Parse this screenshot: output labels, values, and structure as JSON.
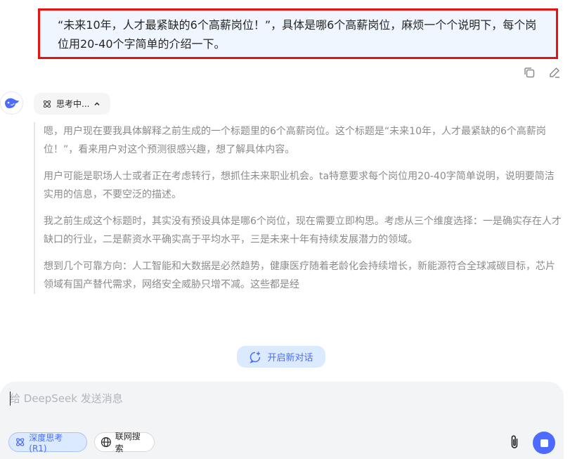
{
  "user_message": {
    "text": "“未来10年，人才最紧缺的6个高薪岗位！”，具体是哪6个高薪岗位，麻烦一个个说明下，每个岗位用20-40个字简单的介绍一下。"
  },
  "message_actions": {
    "copy_icon": "copy-icon",
    "edit_icon": "edit-icon"
  },
  "assistant": {
    "avatar_icon": "deepseek-whale-icon",
    "thinking_label": "思考中...",
    "thinking_paragraphs": [
      "嗯，用户现在要我具体解释之前生成的一个标题里的6个高薪岗位。这个标题是“未来10年，人才最紧缺的6个高薪岗位！”，看来用户对这个预测很感兴趣，想了解具体内容。",
      "用户可能是职场人士或者正在考虑转行，想抓住未来职业机会。ta特意要求每个岗位用20-40字简单说明，说明要简洁实用的信息，不要空泛的描述。",
      "我之前生成这个标题时，其实没有预设具体是哪6个岗位，现在需要立即构思。考虑从三个维度选择：一是确实存在人才缺口的行业，二是薪资水平确实高于平均水平，三是未来十年有持续发展潜力的领域。",
      "想到几个可靠方向：人工智能和大数据是必然趋势，健康医疗随着老龄化会持续增长，新能源符合全球减碳目标，芯片领域有国产替代需求，网络安全威胁只增不减。这些都是经"
    ]
  },
  "new_chat": {
    "label": "开启新对话"
  },
  "composer": {
    "placeholder": "给 DeepSeek 发送消息",
    "deep_think_label": "深度思考 (R1)",
    "web_search_label": "联网搜索"
  },
  "colors": {
    "accent": "#4d6bfe",
    "highlight_border": "#e8130f",
    "user_bubble_bg": "#eff6ff"
  }
}
